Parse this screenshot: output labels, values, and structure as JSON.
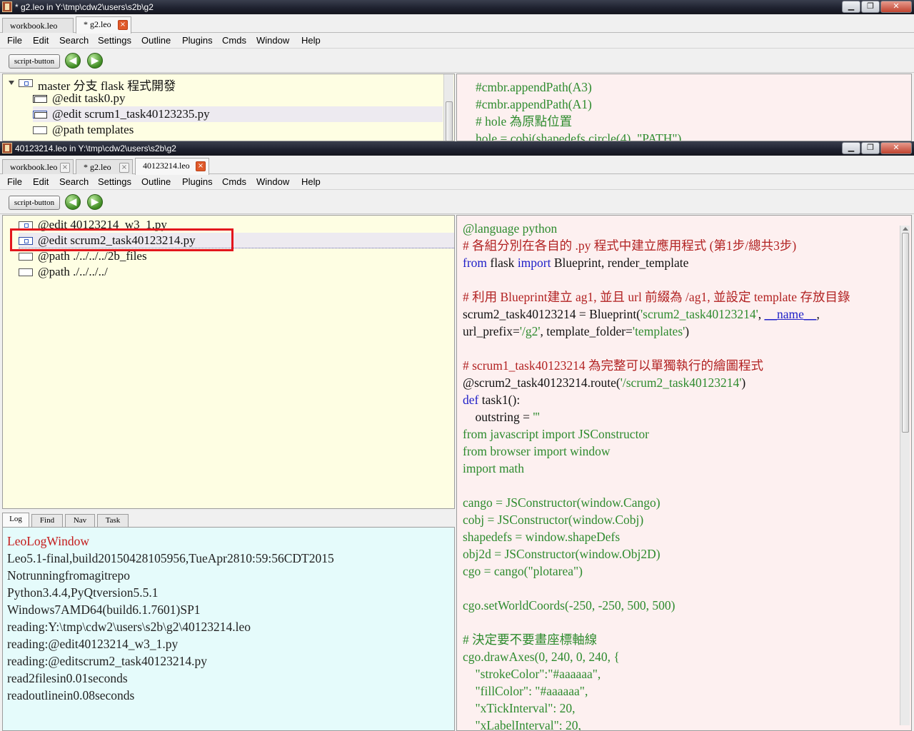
{
  "window1": {
    "title": "* g2.leo in Y:\\tmp\\cdw2\\users\\s2b\\g2",
    "tabs": [
      {
        "label": "workbook.leo",
        "close": "×"
      },
      {
        "label": "* g2.leo",
        "close": "×"
      }
    ],
    "menu": [
      "File",
      "Edit",
      "Search",
      "Settings",
      "Outline",
      "Plugins",
      "Cmds",
      "Window",
      "Help"
    ],
    "script_button": "script-button",
    "outline": [
      "master 分支 flask 程式開發",
      "@edit task0.py",
      "@edit scrum1_task40123235.py",
      "@path templates"
    ],
    "body_lines": [
      "#cmbr.appendPath(A3)",
      "#cmbr.appendPath(A1)",
      "# hole 為原點位置",
      "hole = cobj(shapedefs.circle(4), \"PATH\")"
    ]
  },
  "window2": {
    "title": "40123214.leo in Y:\\tmp\\cdw2\\users\\s2b\\g2",
    "tabs": [
      {
        "label": "workbook.leo",
        "close": "×"
      },
      {
        "label": "* g2.leo",
        "close": "×"
      },
      {
        "label": "40123214.leo",
        "close": "×"
      }
    ],
    "menu": [
      "File",
      "Edit",
      "Search",
      "Settings",
      "Outline",
      "Plugins",
      "Cmds",
      "Window",
      "Help"
    ],
    "script_button": "script-button",
    "outline": [
      "@edit 40123214_w3_1.py",
      "@edit scrum2_task40123214.py",
      "@path ./../../../2b_files",
      "@path ./../../../"
    ],
    "log_tabs": [
      "Log",
      "Find",
      "Nav",
      "Task"
    ],
    "log_lines": [
      "LeoLogWindow",
      "Leo5.1-final,build20150428105956,TueApr2810:59:56CDT2015",
      "Notrunningfromagitrepo",
      "Python3.4.4,PyQtversion5.5.1",
      "Windows7AMD64(build6.1.7601)SP1",
      "reading:Y:\\tmp\\cdw2\\users\\s2b\\g2\\40123214.leo",
      "reading:@edit40123214_w3_1.py",
      "reading:@editscrum2_task40123214.py",
      "read2filesin0.01seconds",
      "readoutlinein0.08seconds"
    ],
    "code": {
      "l1": "@language python",
      "l2": "# 各組分別在各自的 .py 程式中建立應用程式 (第1步/總共3步)",
      "l3_a": "from",
      "l3_b": " flask ",
      "l3_c": "import",
      "l3_d": " Blueprint, render_template",
      "l5": "# 利用 Blueprint建立 ag1, 並且 url 前綴為 /ag1, 並設定 template 存放目錄",
      "l6_a": "scrum2_task40123214 = Blueprint(",
      "l6_b": "'scrum2_task40123214'",
      "l6_c": ", ",
      "l6_d": "__name__",
      "l6_e": ",",
      "l7_a": "url_prefix=",
      "l7_b": "'/g2'",
      "l7_c": ", template_folder=",
      "l7_d": "'templates'",
      "l7_e": ")",
      "l9": "# scrum1_task40123214 為完整可以單獨執行的繪圖程式",
      "l10_a": "@scrum2_task40123214.route(",
      "l10_b": "'/scrum2_task40123214'",
      "l10_c": ")",
      "l11_a": "def",
      "l11_b": " task1():",
      "l12_a": "    outstring = ",
      "l12_b": "'''",
      "l13": "from javascript import JSConstructor",
      "l14": "from browser import window",
      "l15": "import math",
      "l17": "cango = JSConstructor(window.Cango)",
      "l18": "cobj = JSConstructor(window.Cobj)",
      "l19": "shapedefs = window.shapeDefs",
      "l20": "obj2d = JSConstructor(window.Obj2D)",
      "l21": "cgo = cango(\"plotarea\")",
      "l23": "cgo.setWorldCoords(-250, -250, 500, 500)",
      "l25": "# 決定要不要畫座標軸線",
      "l26": "cgo.drawAxes(0, 240, 0, 240, {",
      "l27": "    \"strokeColor\":\"#aaaaaa\",",
      "l28": "    \"fillColor\": \"#aaaaaa\",",
      "l29": "    \"xTickInterval\": 20,",
      "l30": "    \"xLabelInterval\": 20,"
    }
  },
  "colors": {
    "outline_bg": "#fefee3",
    "body_bg": "#fdf0f0",
    "log_bg": "#e5fbfb",
    "highlight": "#e3161d"
  }
}
